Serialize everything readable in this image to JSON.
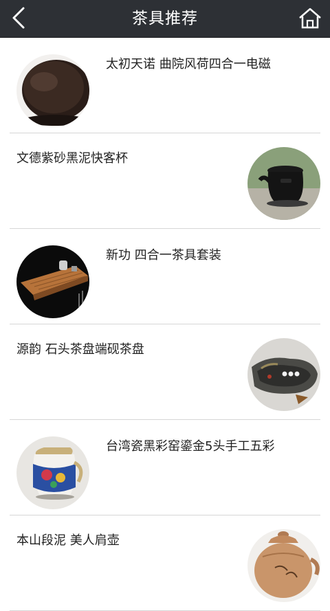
{
  "header": {
    "title": "茶具推荐",
    "back_icon": "chevron-left-icon",
    "home_icon": "home-icon"
  },
  "items": [
    {
      "name": "太初天诺 曲院风荷四合一电磁",
      "image": "electric-stove-image"
    },
    {
      "name": "文德紫砂黑泥快客杯",
      "image": "black-clay-cup-image"
    },
    {
      "name": "新功 四合一茶具套装",
      "image": "tea-tray-set-image"
    },
    {
      "name": "源韵 石头茶盘端砚茶盘",
      "image": "stone-tea-tray-image"
    },
    {
      "name": "台湾瓷黑彩窑鎏金5头手工五彩",
      "image": "porcelain-pitcher-image"
    },
    {
      "name": "本山段泥 美人肩壶",
      "image": "clay-teapot-image"
    }
  ]
}
